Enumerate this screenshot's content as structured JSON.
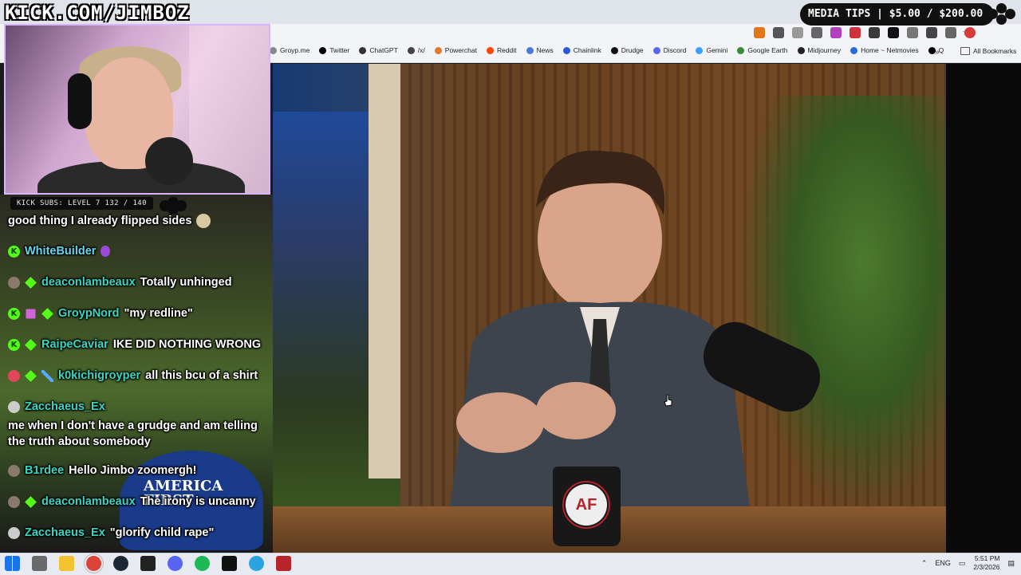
{
  "overlay": {
    "kick_url": "KICK.COM/JIMBOZ",
    "media_tips": "MEDIA TIPS | $5.00 / $200.00",
    "kick_subs": "KICK SUBS: LEVEL 7 132 / 140"
  },
  "browser": {
    "bookmarks": [
      {
        "label": "Groyp.me",
        "color": "#888888"
      },
      {
        "label": "Twitter",
        "color": "#000000"
      },
      {
        "label": "ChatGPT",
        "color": "#333333"
      },
      {
        "label": "/x/",
        "color": "#444444"
      },
      {
        "label": "Powerchat",
        "color": "#e07a2e"
      },
      {
        "label": "Reddit",
        "color": "#ff4500"
      },
      {
        "label": "News",
        "color": "#4a79d8"
      },
      {
        "label": "Chainlink",
        "color": "#2a5ada"
      },
      {
        "label": "Drudge",
        "color": "#111111"
      },
      {
        "label": "Discord",
        "color": "#5865f2"
      },
      {
        "label": "Gemini",
        "color": "#3aa0ff"
      },
      {
        "label": "Google Earth",
        "color": "#3a8a3a"
      },
      {
        "label": "Midjourney",
        "color": "#222222"
      },
      {
        "label": "Home ~ Netmovies",
        "color": "#2a6ad8"
      },
      {
        "label": "Q",
        "color": "#000000"
      }
    ],
    "all_bookmarks": "All Bookmarks"
  },
  "video": {
    "mug_logo": "AF",
    "hat_text": "AMERICA FIRST"
  },
  "chat": [
    {
      "user": "",
      "message": "good thing I already flipped sides",
      "user_color": "#ffffff"
    },
    {
      "user": "WhiteBuilder",
      "message": "",
      "user_color": "#64d8f0"
    },
    {
      "user": "deaconlambeaux",
      "message": "Totally unhinged",
      "user_color": "#3ad6c4"
    },
    {
      "user": "GroypNord",
      "message": "\"my redline\"",
      "user_color": "#3ad6c4"
    },
    {
      "user": "RaipeCaviar",
      "message": "IKE DID NOTHING WRONG",
      "user_color": "#3ad6c4"
    },
    {
      "user": "k0kichigroyper",
      "message": "all this bcu of a shirt",
      "user_color": "#3ad6c4"
    },
    {
      "user": "Zacchaeus_Ex",
      "message": "",
      "user_color": "#3ad6c4"
    },
    {
      "user": "",
      "message": "me when I don't have a grudge and am telling the truth about somebody",
      "user_color": "#ffffff"
    },
    {
      "user": "B1rdee",
      "message": "Hello Jimbo zoomergh!",
      "user_color": "#3ad6c4"
    },
    {
      "user": "deaconlambeaux",
      "message": "The irony is uncanny",
      "user_color": "#3ad6c4"
    },
    {
      "user": "Zacchaeus_Ex",
      "message": "\"glorify child rape\"",
      "user_color": "#3ad6c4"
    }
  ],
  "taskbar": {
    "language": "ENG",
    "time": "5:51 PM",
    "date": "2/3/2026"
  }
}
